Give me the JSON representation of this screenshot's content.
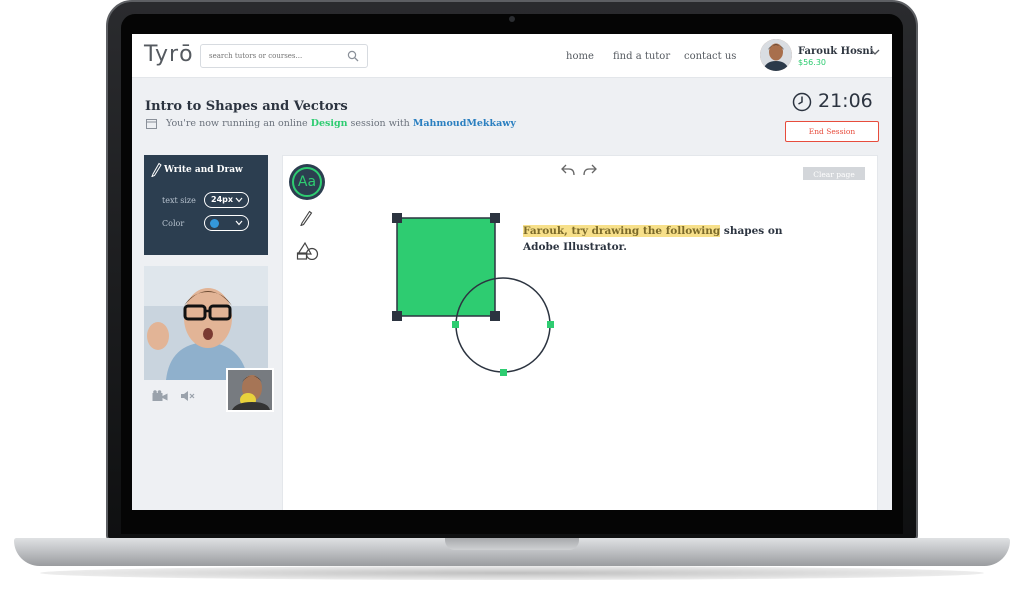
{
  "header": {
    "logo": "Tyrō",
    "search_placeholder": "search tutors or courses...",
    "nav": [
      "home",
      "find a tutor",
      "contact us"
    ],
    "user": {
      "name": "Farouk Hosni",
      "balance": "$56.30"
    }
  },
  "session": {
    "title": "Intro to Shapes and Vectors",
    "subtitle_prefix": "You're now running an online",
    "subject": "Design",
    "subtitle_mid": "session with",
    "tutor": "MahmoudMekkawy",
    "timer": "21:06",
    "end_label": "End Session"
  },
  "tools": {
    "heading": "Write and Draw",
    "text_size_label": "text size",
    "text_size_value": "24px",
    "color_label": "Color",
    "color_value": "#3498db"
  },
  "canvas": {
    "font_button": "Aa",
    "clear_label": "Clear page",
    "note_highlight": "Farouk, try drawing the following",
    "note_rest": " shapes on Adobe Illustrator.",
    "square_fill": "#2ecc71"
  },
  "colors": {
    "accent_green": "#2ecc71",
    "danger": "#e74c3c",
    "panel": "#2c3e50",
    "link_blue": "#2a7fc0"
  }
}
